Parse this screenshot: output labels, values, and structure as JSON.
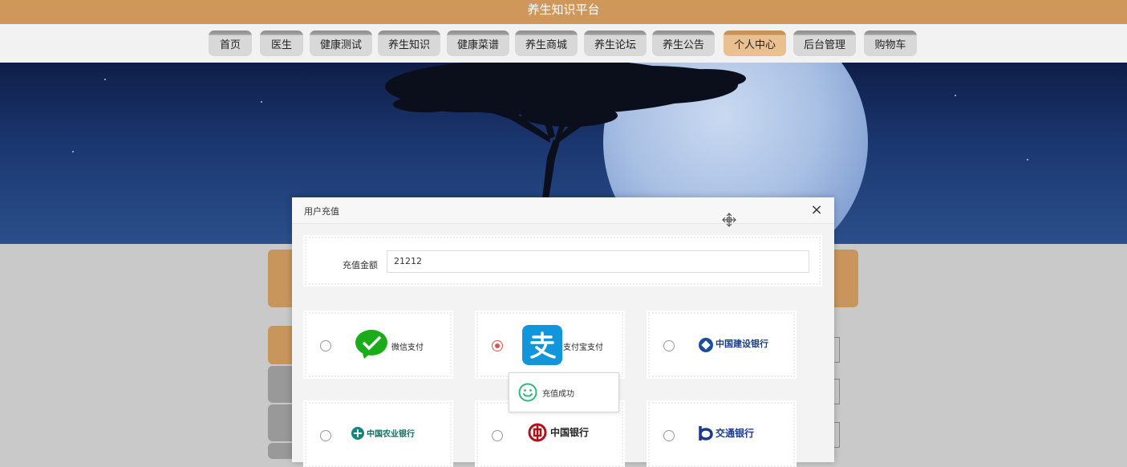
{
  "header": {
    "title": "养生知识平台"
  },
  "nav": {
    "items": [
      {
        "label": "首页"
      },
      {
        "label": "医生"
      },
      {
        "label": "健康测试"
      },
      {
        "label": "养生知识"
      },
      {
        "label": "健康菜谱"
      },
      {
        "label": "养生商城"
      },
      {
        "label": "养生论坛"
      },
      {
        "label": "养生公告"
      },
      {
        "label": "个人中心",
        "active": true
      },
      {
        "label": "后台管理"
      },
      {
        "label": "购物车"
      }
    ]
  },
  "modal": {
    "title": "用户充值",
    "close_label": "×",
    "amount_label": "充值金额",
    "amount_value": "21212",
    "payments": [
      {
        "label": "微信支付",
        "icon": "wechat-pay-icon",
        "checked": false
      },
      {
        "label": "支付宝支付",
        "icon": "alipay-icon",
        "checked": true
      },
      {
        "label": "中国建设银行",
        "icon": "ccb-logo",
        "checked": false
      },
      {
        "label": "中国农业银行",
        "icon": "abc-logo",
        "checked": false
      },
      {
        "label": "中国银行",
        "icon": "boc-logo",
        "checked": false
      },
      {
        "label": "交通银行",
        "icon": "bocom-logo",
        "checked": false
      }
    ]
  },
  "toast": {
    "text": "充值成功",
    "icon": "smile-icon"
  },
  "colors": {
    "brand": "#d0975a",
    "alipay": "#1296db",
    "wechat": "#1aad19",
    "radio_checked": "#d9534f"
  }
}
